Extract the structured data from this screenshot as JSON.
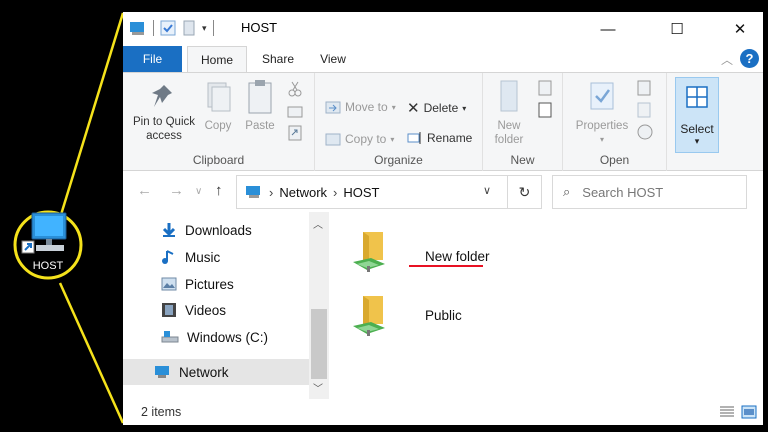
{
  "window": {
    "title": "HOST",
    "minimize_glyph": "—",
    "maximize_glyph": "☐",
    "close_glyph": "✕"
  },
  "desktop": {
    "shortcut_label": "HOST",
    "callout_color": "#f5e21b"
  },
  "ribbon": {
    "tabs": {
      "file": "File",
      "home": "Home",
      "share": "Share",
      "view": "View"
    },
    "help": "?",
    "clipboard": {
      "pin_line1": "Pin to Quick",
      "pin_line2": "access",
      "copy": "Copy",
      "paste": "Paste",
      "group": "Clipboard"
    },
    "organize": {
      "move_to": "Move to",
      "copy_to": "Copy to",
      "delete": "Delete",
      "rename": "Rename",
      "group": "Organize"
    },
    "new": {
      "new_line1": "New",
      "new_line2": "folder",
      "group": "New"
    },
    "open": {
      "properties": "Properties",
      "group": "Open"
    },
    "select": {
      "select": "Select"
    }
  },
  "address": {
    "crumb1": "Network",
    "crumb2": "HOST",
    "search_placeholder": "Search HOST"
  },
  "nav": {
    "items": [
      {
        "label": "Downloads",
        "icon": "download-arrow-icon"
      },
      {
        "label": "Music",
        "icon": "music-note-icon"
      },
      {
        "label": "Pictures",
        "icon": "pictures-icon"
      },
      {
        "label": "Videos",
        "icon": "film-icon"
      },
      {
        "label": "Windows (C:)",
        "icon": "drive-icon"
      },
      {
        "label": "Network",
        "icon": "network-icon"
      }
    ],
    "selected": "Network"
  },
  "content": {
    "items": [
      {
        "name": "New folder",
        "icon": "shared-folder-icon"
      },
      {
        "name": "Public",
        "icon": "shared-folder-icon"
      }
    ],
    "highlight_color": "#e81123"
  },
  "status": {
    "item_count": "2 items"
  },
  "colors": {
    "accent": "#1a6fc3",
    "folder": "#f0c34b",
    "network_green": "#4caf50"
  }
}
